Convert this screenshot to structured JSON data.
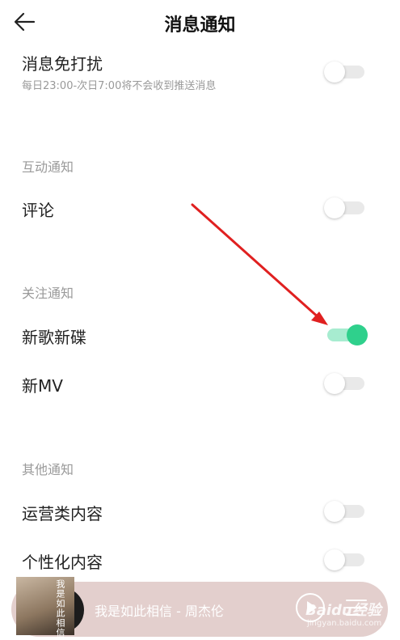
{
  "header": {
    "title": "消息通知"
  },
  "dnd": {
    "label": "消息免打扰",
    "subtitle": "每日23:00-次日7:00将不会收到推送消息",
    "enabled": false
  },
  "interaction_section": {
    "title": "互动通知",
    "items": [
      {
        "label": "评论",
        "enabled": false
      }
    ]
  },
  "follow_section": {
    "title": "关注通知",
    "items": [
      {
        "label": "新歌新碟",
        "enabled": true
      },
      {
        "label": "新MV",
        "enabled": false
      }
    ]
  },
  "other_section": {
    "title": "其他通知",
    "items": [
      {
        "label": "运营类内容",
        "enabled": false
      },
      {
        "label": "个性化内容",
        "enabled": false
      }
    ]
  },
  "player": {
    "song": "我是如此相信 - 周杰伦",
    "album_art_text": "我是如此相信"
  },
  "watermark": {
    "logo": "Baidu经验",
    "url": "jingyan.baidu.com"
  },
  "colors": {
    "toggle_on": "#2fd08c",
    "toggle_on_track": "#a7ecd0",
    "annotation_arrow": "#e02020",
    "player_bg": "#e3cfcd"
  }
}
